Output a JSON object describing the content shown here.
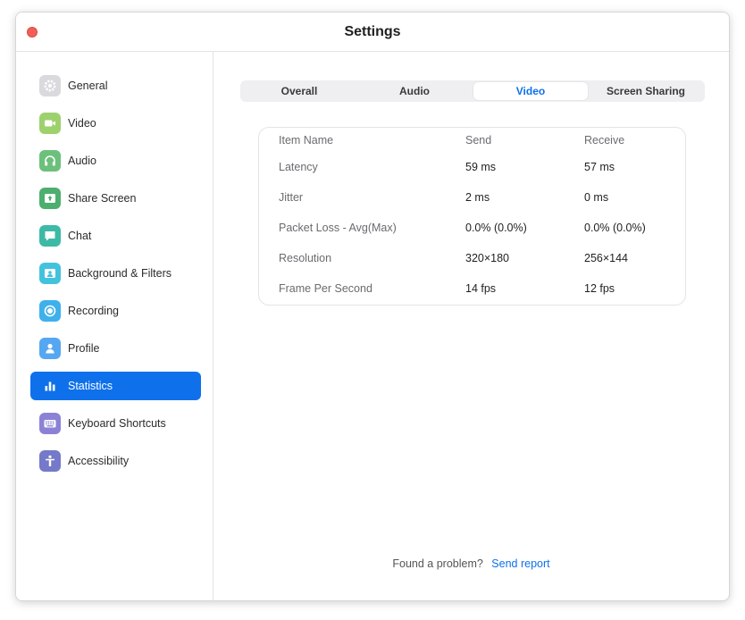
{
  "window": {
    "title": "Settings"
  },
  "sidebar": {
    "items": [
      {
        "label": "General",
        "icon": "gear-icon",
        "color": "#d9d9de",
        "active": false
      },
      {
        "label": "Video",
        "icon": "video-camera-icon",
        "color": "#9dd16e",
        "active": false
      },
      {
        "label": "Audio",
        "icon": "headphones-icon",
        "color": "#6cc07b",
        "active": false
      },
      {
        "label": "Share Screen",
        "icon": "share-screen-icon",
        "color": "#4caf6e",
        "active": false
      },
      {
        "label": "Chat",
        "icon": "chat-bubble-icon",
        "color": "#3dbaa6",
        "active": false
      },
      {
        "label": "Background & Filters",
        "icon": "background-person-icon",
        "color": "#43c2dd",
        "active": false
      },
      {
        "label": "Recording",
        "icon": "record-icon",
        "color": "#3eb0ec",
        "active": false
      },
      {
        "label": "Profile",
        "icon": "profile-person-icon",
        "color": "#55a7f2",
        "active": false
      },
      {
        "label": "Statistics",
        "icon": "bar-chart-icon",
        "color": "#0e71eb",
        "active": true
      },
      {
        "label": "Keyboard Shortcuts",
        "icon": "keyboard-icon",
        "color": "#8b82d6",
        "active": false
      },
      {
        "label": "Accessibility",
        "icon": "accessibility-icon",
        "color": "#7479c9",
        "active": false
      }
    ]
  },
  "tabs": [
    {
      "label": "Overall",
      "active": false
    },
    {
      "label": "Audio",
      "active": false
    },
    {
      "label": "Video",
      "active": true
    },
    {
      "label": "Screen Sharing",
      "active": false
    }
  ],
  "stats": {
    "headers": [
      "Item Name",
      "Send",
      "Receive"
    ],
    "rows": [
      [
        "Latency",
        "59 ms",
        "57 ms"
      ],
      [
        "Jitter",
        "2 ms",
        "0 ms"
      ],
      [
        "Packet Loss - Avg(Max)",
        "0.0% (0.0%)",
        "0.0% (0.0%)"
      ],
      [
        "Resolution",
        "320×180",
        "256×144"
      ],
      [
        "Frame Per Second",
        "14 fps",
        "12 fps"
      ]
    ]
  },
  "footer": {
    "text": "Found a problem?",
    "link": "Send report"
  },
  "colors": {
    "accent": "#0e71eb",
    "close": "#f25f58"
  }
}
